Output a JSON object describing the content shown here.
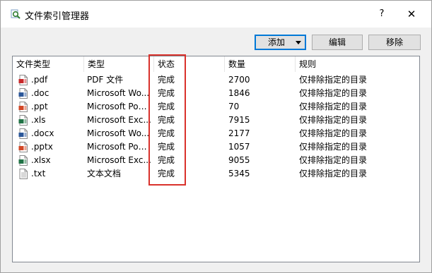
{
  "window": {
    "title": "文件索引管理器",
    "help_label": "?",
    "close_label": "✕"
  },
  "toolbar": {
    "add_label": "添加",
    "edit_label": "编辑",
    "remove_label": "移除"
  },
  "table": {
    "columns": [
      "文件类型",
      "类型",
      "状态",
      "数量",
      "规则"
    ],
    "rows": [
      {
        "ext": ".pdf",
        "type": "PDF 文件",
        "status": "完成",
        "count": "2700",
        "rule": "仅排除指定的目录",
        "icon": "pdf-file-icon",
        "color": "#c8282a"
      },
      {
        "ext": ".doc",
        "type": "Microsoft Wo...",
        "status": "完成",
        "count": "1846",
        "rule": "仅排除指定的目录",
        "icon": "word-file-icon",
        "color": "#2b579a"
      },
      {
        "ext": ".ppt",
        "type": "Microsoft Pow...",
        "status": "完成",
        "count": "70",
        "rule": "仅排除指定的目录",
        "icon": "powerpoint-file-icon",
        "color": "#d24726"
      },
      {
        "ext": ".xls",
        "type": "Microsoft Exc...",
        "status": "完成",
        "count": "7915",
        "rule": "仅排除指定的目录",
        "icon": "excel-file-icon",
        "color": "#217346"
      },
      {
        "ext": ".docx",
        "type": "Microsoft Wo...",
        "status": "完成",
        "count": "2177",
        "rule": "仅排除指定的目录",
        "icon": "word-file-icon",
        "color": "#2b579a"
      },
      {
        "ext": ".pptx",
        "type": "Microsoft Pow...",
        "status": "完成",
        "count": "1057",
        "rule": "仅排除指定的目录",
        "icon": "powerpoint-file-icon",
        "color": "#d24726"
      },
      {
        "ext": ".xlsx",
        "type": "Microsoft Exc...",
        "status": "完成",
        "count": "9055",
        "rule": "仅排除指定的目录",
        "icon": "excel-file-icon",
        "color": "#217346"
      },
      {
        "ext": ".txt",
        "type": "文本文档",
        "status": "完成",
        "count": "5345",
        "rule": "仅排除指定的目录",
        "icon": "text-file-icon",
        "color": "#9a9a9a"
      }
    ]
  },
  "annotation": {
    "highlight_color": "#d9312b"
  }
}
